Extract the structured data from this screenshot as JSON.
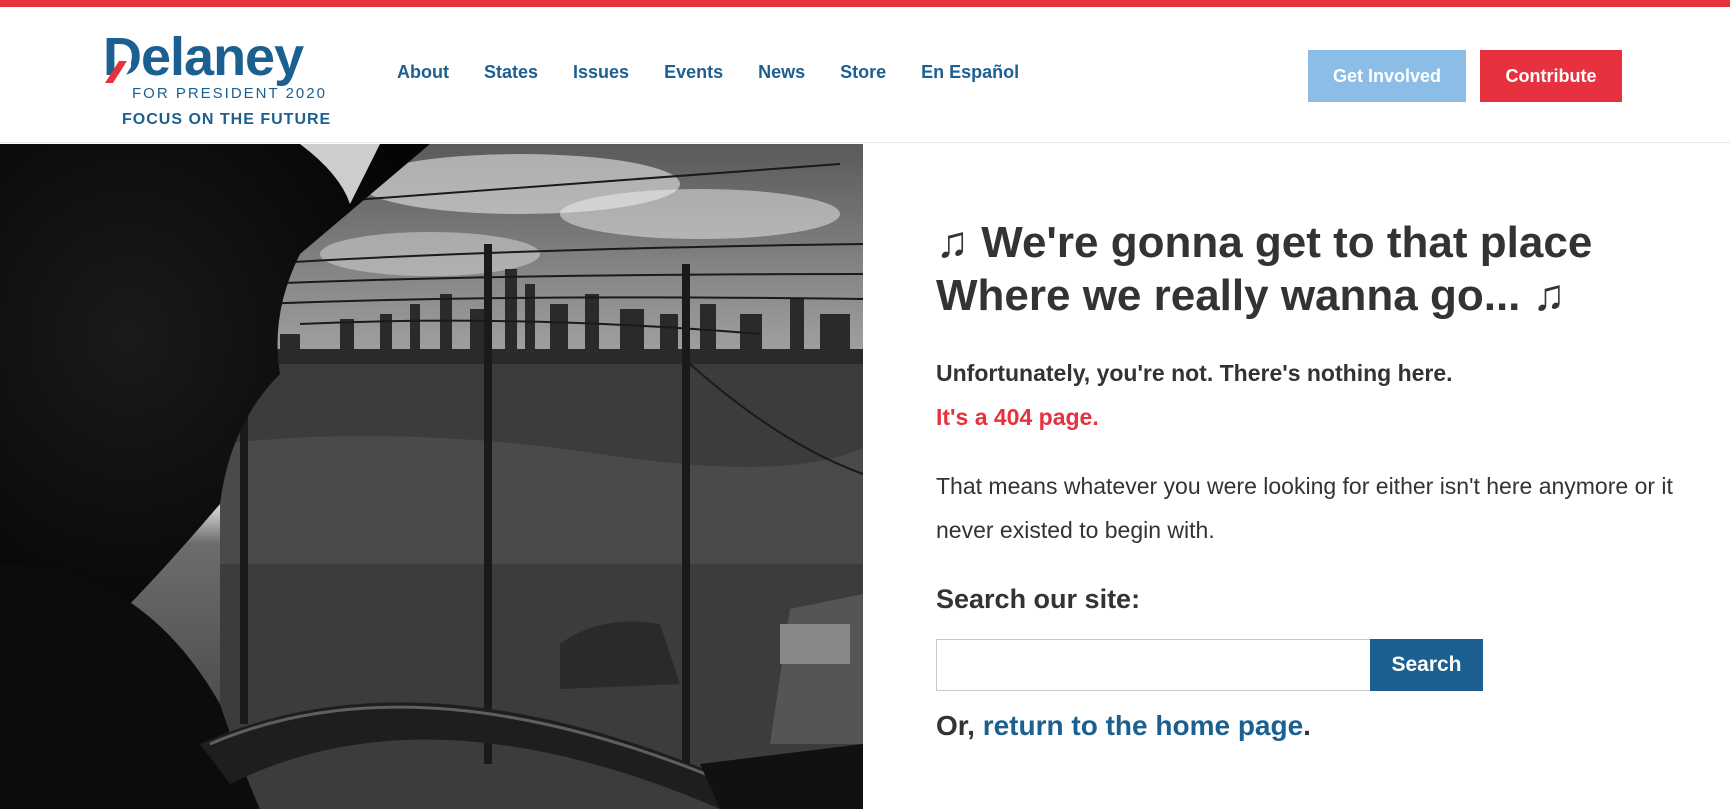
{
  "colors": {
    "accent_red": "#e8313f",
    "brand_blue": "#1c5f91",
    "light_blue": "#8cbde6",
    "text_dark": "#333333"
  },
  "logo": {
    "wordmark": "Delaney",
    "subtitle": "FOR PRESIDENT 2020",
    "tagline": "FOCUS ON THE FUTURE"
  },
  "nav": {
    "items": [
      {
        "label": "About"
      },
      {
        "label": "States"
      },
      {
        "label": "Issues"
      },
      {
        "label": "Events"
      },
      {
        "label": "News"
      },
      {
        "label": "Store"
      },
      {
        "label": "En Español"
      }
    ]
  },
  "header_actions": {
    "get_involved": "Get Involved",
    "contribute": "Contribute"
  },
  "content": {
    "headline_line1": "♫ We're gonna get to that place",
    "headline_line2": "Where we really wanna go... ♫",
    "sorry": "Unfortunately, you're not. There's nothing here.",
    "is404": "It's a 404 page.",
    "explain": "That means whatever you were looking for either isn't here anymore or it never existed to begin with.",
    "search_label": "Search our site:",
    "search_value": "",
    "search_button": "Search",
    "home_prefix": "Or, ",
    "home_link": "return to the home page",
    "home_suffix": "."
  }
}
